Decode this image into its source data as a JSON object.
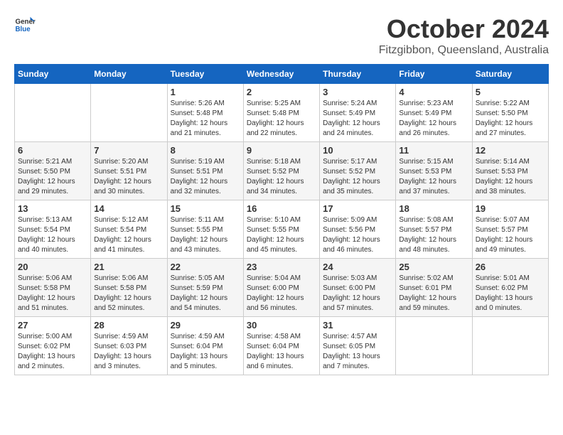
{
  "logo": {
    "line1": "General",
    "line2": "Blue"
  },
  "title": "October 2024",
  "location": "Fitzgibbon, Queensland, Australia",
  "days_of_week": [
    "Sunday",
    "Monday",
    "Tuesday",
    "Wednesday",
    "Thursday",
    "Friday",
    "Saturday"
  ],
  "weeks": [
    [
      {
        "day": "",
        "detail": ""
      },
      {
        "day": "",
        "detail": ""
      },
      {
        "day": "1",
        "detail": "Sunrise: 5:26 AM\nSunset: 5:48 PM\nDaylight: 12 hours\nand 21 minutes."
      },
      {
        "day": "2",
        "detail": "Sunrise: 5:25 AM\nSunset: 5:48 PM\nDaylight: 12 hours\nand 22 minutes."
      },
      {
        "day": "3",
        "detail": "Sunrise: 5:24 AM\nSunset: 5:49 PM\nDaylight: 12 hours\nand 24 minutes."
      },
      {
        "day": "4",
        "detail": "Sunrise: 5:23 AM\nSunset: 5:49 PM\nDaylight: 12 hours\nand 26 minutes."
      },
      {
        "day": "5",
        "detail": "Sunrise: 5:22 AM\nSunset: 5:50 PM\nDaylight: 12 hours\nand 27 minutes."
      }
    ],
    [
      {
        "day": "6",
        "detail": "Sunrise: 5:21 AM\nSunset: 5:50 PM\nDaylight: 12 hours\nand 29 minutes."
      },
      {
        "day": "7",
        "detail": "Sunrise: 5:20 AM\nSunset: 5:51 PM\nDaylight: 12 hours\nand 30 minutes."
      },
      {
        "day": "8",
        "detail": "Sunrise: 5:19 AM\nSunset: 5:51 PM\nDaylight: 12 hours\nand 32 minutes."
      },
      {
        "day": "9",
        "detail": "Sunrise: 5:18 AM\nSunset: 5:52 PM\nDaylight: 12 hours\nand 34 minutes."
      },
      {
        "day": "10",
        "detail": "Sunrise: 5:17 AM\nSunset: 5:52 PM\nDaylight: 12 hours\nand 35 minutes."
      },
      {
        "day": "11",
        "detail": "Sunrise: 5:15 AM\nSunset: 5:53 PM\nDaylight: 12 hours\nand 37 minutes."
      },
      {
        "day": "12",
        "detail": "Sunrise: 5:14 AM\nSunset: 5:53 PM\nDaylight: 12 hours\nand 38 minutes."
      }
    ],
    [
      {
        "day": "13",
        "detail": "Sunrise: 5:13 AM\nSunset: 5:54 PM\nDaylight: 12 hours\nand 40 minutes."
      },
      {
        "day": "14",
        "detail": "Sunrise: 5:12 AM\nSunset: 5:54 PM\nDaylight: 12 hours\nand 41 minutes."
      },
      {
        "day": "15",
        "detail": "Sunrise: 5:11 AM\nSunset: 5:55 PM\nDaylight: 12 hours\nand 43 minutes."
      },
      {
        "day": "16",
        "detail": "Sunrise: 5:10 AM\nSunset: 5:55 PM\nDaylight: 12 hours\nand 45 minutes."
      },
      {
        "day": "17",
        "detail": "Sunrise: 5:09 AM\nSunset: 5:56 PM\nDaylight: 12 hours\nand 46 minutes."
      },
      {
        "day": "18",
        "detail": "Sunrise: 5:08 AM\nSunset: 5:57 PM\nDaylight: 12 hours\nand 48 minutes."
      },
      {
        "day": "19",
        "detail": "Sunrise: 5:07 AM\nSunset: 5:57 PM\nDaylight: 12 hours\nand 49 minutes."
      }
    ],
    [
      {
        "day": "20",
        "detail": "Sunrise: 5:06 AM\nSunset: 5:58 PM\nDaylight: 12 hours\nand 51 minutes."
      },
      {
        "day": "21",
        "detail": "Sunrise: 5:06 AM\nSunset: 5:58 PM\nDaylight: 12 hours\nand 52 minutes."
      },
      {
        "day": "22",
        "detail": "Sunrise: 5:05 AM\nSunset: 5:59 PM\nDaylight: 12 hours\nand 54 minutes."
      },
      {
        "day": "23",
        "detail": "Sunrise: 5:04 AM\nSunset: 6:00 PM\nDaylight: 12 hours\nand 56 minutes."
      },
      {
        "day": "24",
        "detail": "Sunrise: 5:03 AM\nSunset: 6:00 PM\nDaylight: 12 hours\nand 57 minutes."
      },
      {
        "day": "25",
        "detail": "Sunrise: 5:02 AM\nSunset: 6:01 PM\nDaylight: 12 hours\nand 59 minutes."
      },
      {
        "day": "26",
        "detail": "Sunrise: 5:01 AM\nSunset: 6:02 PM\nDaylight: 13 hours\nand 0 minutes."
      }
    ],
    [
      {
        "day": "27",
        "detail": "Sunrise: 5:00 AM\nSunset: 6:02 PM\nDaylight: 13 hours\nand 2 minutes."
      },
      {
        "day": "28",
        "detail": "Sunrise: 4:59 AM\nSunset: 6:03 PM\nDaylight: 13 hours\nand 3 minutes."
      },
      {
        "day": "29",
        "detail": "Sunrise: 4:59 AM\nSunset: 6:04 PM\nDaylight: 13 hours\nand 5 minutes."
      },
      {
        "day": "30",
        "detail": "Sunrise: 4:58 AM\nSunset: 6:04 PM\nDaylight: 13 hours\nand 6 minutes."
      },
      {
        "day": "31",
        "detail": "Sunrise: 4:57 AM\nSunset: 6:05 PM\nDaylight: 13 hours\nand 7 minutes."
      },
      {
        "day": "",
        "detail": ""
      },
      {
        "day": "",
        "detail": ""
      }
    ]
  ]
}
